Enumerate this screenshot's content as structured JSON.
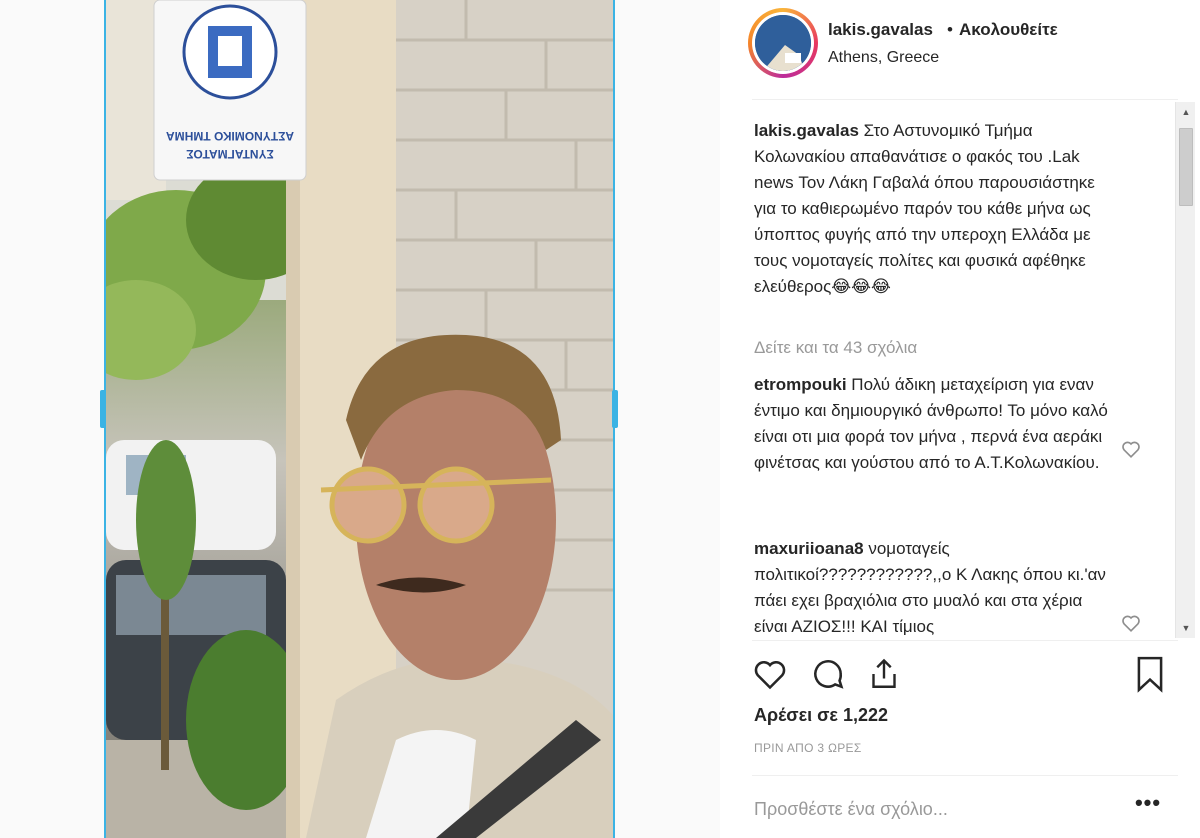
{
  "post": {
    "username": "lakis.gavalas",
    "separator": "•",
    "follow_label": "Ακολουθείτε",
    "location": "Athens, Greece"
  },
  "photo": {
    "sign_line1": "ΑΣΤΥΝΟΜΙΚΟ ΤΜΗΜΑ",
    "sign_line2": "ΣΥΝΤΑΓΜΑΤΟΣ"
  },
  "caption": {
    "username": "lakis.gavalas",
    "text": "Στο Αστυνομικό Τμήμα Κολωνακίου απαθανάτισε ο φακός του .Lak news Τον Λάκη Γαβαλά όπου παρουσιάστηκε για το καθιερωμένο παρόν του κάθε μήνα ως ύποπτος φυγής από την υπεροχη Ελλάδα με τους νομοταγείς πολίτες και φυσικά αφέθηκε ελεύθερος😂😂😂"
  },
  "view_all_comments": "Δείτε και τα 43 σχόλια",
  "comments": [
    {
      "username": "etrompouki",
      "text": "Πολύ άδικη μεταχείριση για εναν έντιμο και δημιουργικό άνθρωπο! Το μόνο καλό είναι οτι μια φορά τον μήνα , περνά ένα αεράκι φινέτσας και γούστου από το Α.Τ.Κολωνακίου."
    },
    {
      "username": "maxuriioana8",
      "text": "νομοταγείς πολιτικοί????????????,,ο Κ Λακης όπου κι.'αν πάει εχει βραχιόλια στο μυαλό και στα χέρια είναι ΑΖΙΟΣ!!! ΚΑΙ τίμιος"
    }
  ],
  "likes_text": "Αρέσει σε 1,222",
  "timestamp": "ΠΡΙΝ ΑΠΟ 3 ΩΡΕΣ",
  "add_comment_placeholder": "Προσθέστε ένα σχόλιο...",
  "more_label": "•••",
  "icons": {
    "like": "heart-icon",
    "comment": "comment-bubble-icon",
    "share": "share-icon",
    "save": "bookmark-icon",
    "comment_like": "heart-icon"
  },
  "colors": {
    "selection_handles": "#3bb3e4",
    "muted_text": "#999999",
    "text": "#262626"
  }
}
